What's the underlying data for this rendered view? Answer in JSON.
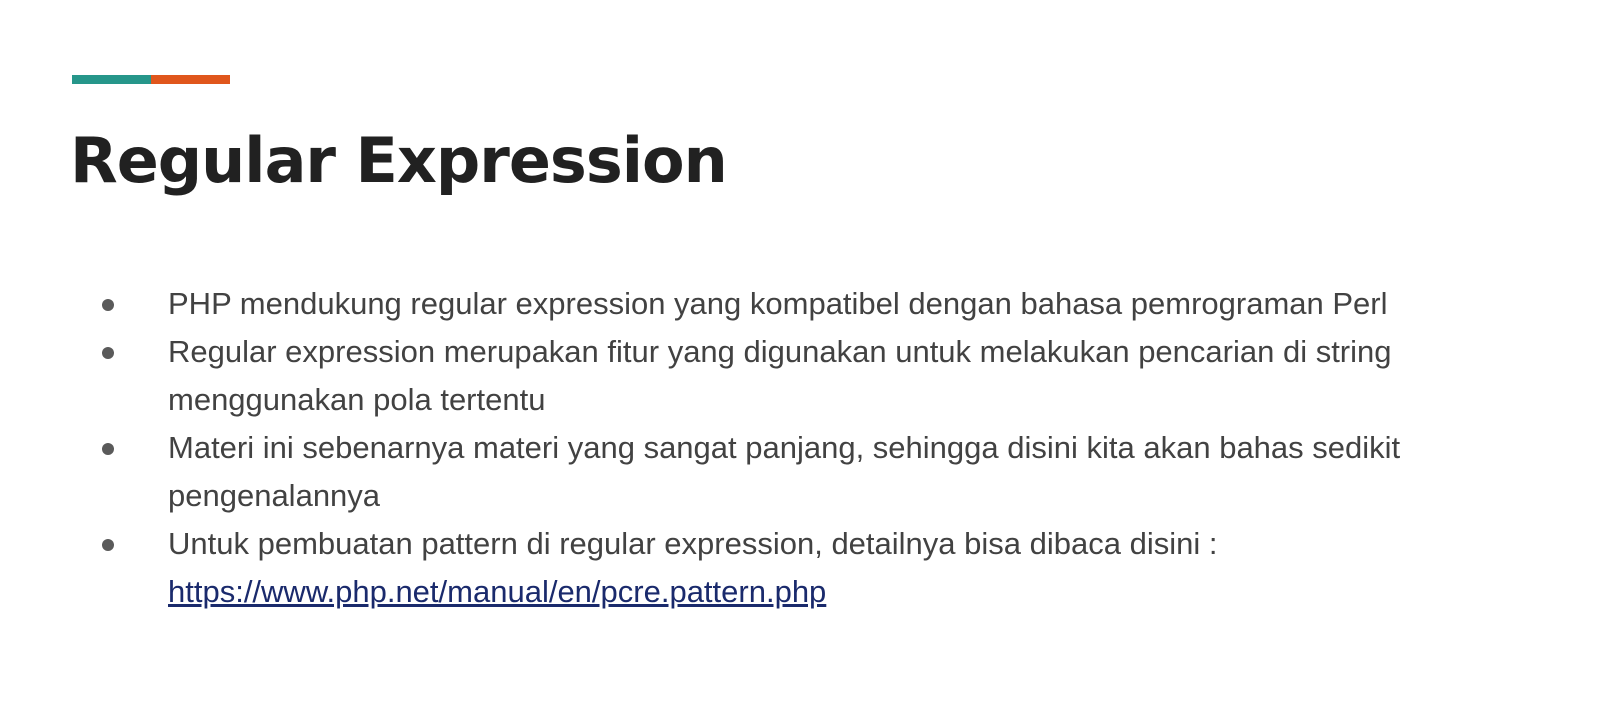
{
  "colors": {
    "accent_teal": "#26968a",
    "accent_orange": "#e0561c",
    "title": "#212121",
    "body_text": "#424242",
    "bullet": "#5a5a5a",
    "link": "#1a2a6c"
  },
  "slide": {
    "title": "Regular Expression",
    "bullets": [
      {
        "text": "PHP mendukung regular expression yang kompatibel dengan bahasa pemrograman Perl"
      },
      {
        "text": "Regular expression merupakan fitur yang digunakan untuk melakukan pencarian di string menggunakan pola tertentu"
      },
      {
        "text": "Materi ini sebenarnya materi yang sangat panjang, sehingga disini kita akan bahas sedikit pengenalannya"
      },
      {
        "text": "Untuk pembuatan pattern di regular expression, detailnya bisa dibaca disini :",
        "link": "https://www.php.net/manual/en/pcre.pattern.php"
      }
    ]
  }
}
